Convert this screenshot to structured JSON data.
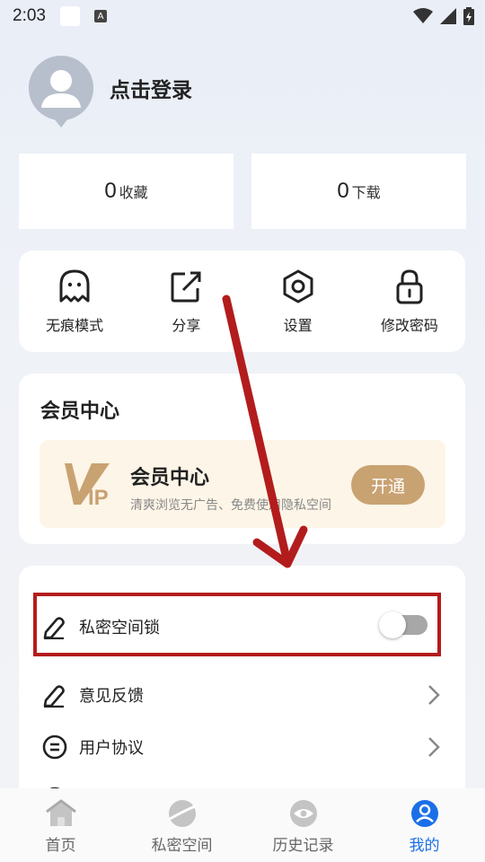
{
  "status_bar": {
    "time": "2:03",
    "a_badge": "A"
  },
  "profile": {
    "login_text": "点击登录"
  },
  "stats": [
    {
      "count": "0",
      "label": "收藏"
    },
    {
      "count": "0",
      "label": "下载"
    }
  ],
  "tools": [
    {
      "label": "无痕模式",
      "icon": "ghost-icon"
    },
    {
      "label": "分享",
      "icon": "share-icon"
    },
    {
      "label": "设置",
      "icon": "hexagon-settings-icon"
    },
    {
      "label": "修改密码",
      "icon": "lock-icon"
    }
  ],
  "vip": {
    "section_title": "会员中心",
    "banner_title": "会员中心",
    "banner_subtitle": "清爽浏览无广告、免费使用隐私空间",
    "open_button": "开通",
    "logo_text": "IP",
    "accent_color": "#c9a272"
  },
  "list": [
    {
      "label": "私密空间锁",
      "icon": "pencil-icon",
      "toggle_on": false
    },
    {
      "label": "意见反馈",
      "icon": "pencil-icon"
    },
    {
      "label": "用户协议",
      "icon": "document-circle-icon"
    }
  ],
  "bottom_nav": [
    {
      "label": "首页",
      "icon": "home-icon",
      "active": false
    },
    {
      "label": "私密空间",
      "icon": "planet-icon",
      "active": false
    },
    {
      "label": "历史记录",
      "icon": "eye-icon",
      "active": false
    },
    {
      "label": "我的",
      "icon": "user-icon",
      "active": true
    }
  ],
  "colors": {
    "active": "#1a6fe8",
    "annotation": "#b31c1c"
  }
}
